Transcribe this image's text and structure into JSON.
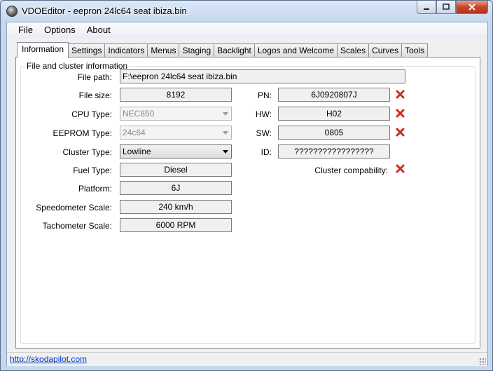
{
  "window": {
    "title": "VDOEditor - eepron 24lc64 seat ibiza.bin"
  },
  "menu": [
    "File",
    "Options",
    "About"
  ],
  "tabs": [
    "Information",
    "Settings",
    "Indicators",
    "Menus",
    "Staging",
    "Backlight",
    "Logos and Welcome",
    "Scales",
    "Curves",
    "Tools"
  ],
  "active_tab": "Information",
  "group": {
    "title": "File and cluster information"
  },
  "fields": {
    "file_path": {
      "label": "File path:",
      "value": "F:\\eepron 24lc64 seat ibiza.bin"
    },
    "file_size": {
      "label": "File size:",
      "value": "8192"
    },
    "cpu_type": {
      "label": "CPU Type:",
      "value": "NEC850"
    },
    "eeprom_type": {
      "label": "EEPROM Type:",
      "value": "24c64"
    },
    "cluster_type": {
      "label": "Cluster Type:",
      "value": "Lowline"
    },
    "fuel_type": {
      "label": "Fuel Type:",
      "value": "Diesel"
    },
    "platform": {
      "label": "Platform:",
      "value": "6J"
    },
    "speedometer_scale": {
      "label": "Speedometer Scale:",
      "value": "240 km/h"
    },
    "tachometer_scale": {
      "label": "Tachometer Scale:",
      "value": "6000 RPM"
    },
    "pn": {
      "label": "PN:",
      "value": "6J0920807J"
    },
    "hw": {
      "label": "HW:",
      "value": "H02"
    },
    "sw": {
      "label": "SW:",
      "value": "0805"
    },
    "id": {
      "label": "ID:",
      "value": "?????????????????"
    },
    "cluster_compat": {
      "label": "Cluster compability:"
    }
  },
  "status": {
    "link": "http://skodapilot.com"
  },
  "icons": {
    "error": "x-icon",
    "app": "app-icon"
  },
  "colors": {
    "error_red": "#d02a1a",
    "link_blue": "#0033cc"
  }
}
